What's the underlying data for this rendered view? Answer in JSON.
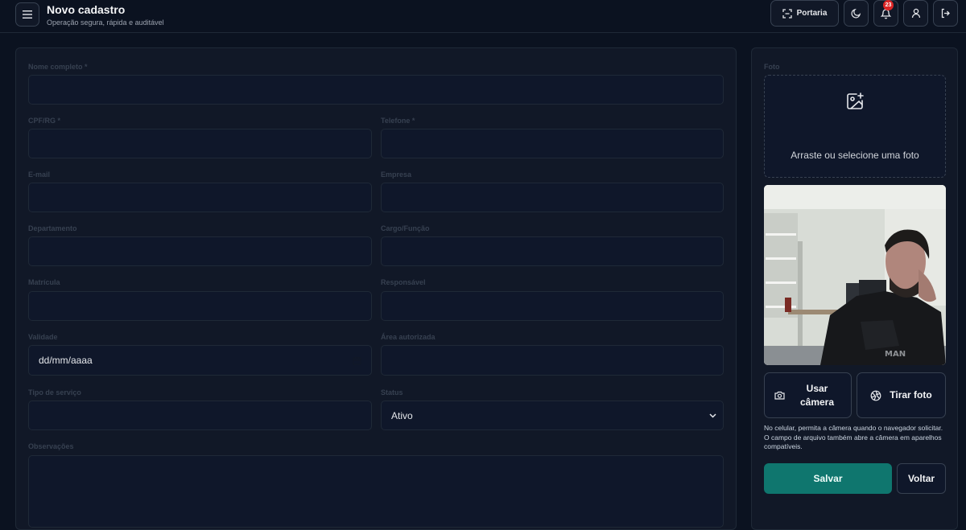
{
  "header": {
    "title": "Novo cadastro",
    "subtitle": "Operação segura, rápida e auditável",
    "portaria_label": "Portaria",
    "notification_count": "23"
  },
  "form": {
    "nome": {
      "label": "Nome completo *",
      "value": ""
    },
    "cpf": {
      "label": "CPF/RG *",
      "value": ""
    },
    "telefone": {
      "label": "Telefone *",
      "value": ""
    },
    "email": {
      "label": "E-mail",
      "value": ""
    },
    "empresa": {
      "label": "Empresa",
      "value": ""
    },
    "departamento": {
      "label": "Departamento",
      "value": ""
    },
    "cargo": {
      "label": "Cargo/Função",
      "value": ""
    },
    "matricula": {
      "label": "Matrícula",
      "value": ""
    },
    "responsavel": {
      "label": "Responsável",
      "value": ""
    },
    "validade": {
      "label": "Validade",
      "placeholder": "dd/mm/aaaa"
    },
    "area": {
      "label": "Área autorizada",
      "value": ""
    },
    "tipo": {
      "label": "Tipo de serviço",
      "value": ""
    },
    "status": {
      "label": "Status",
      "selected": "Ativo"
    },
    "observacoes": {
      "label": "Observações",
      "value": ""
    }
  },
  "photo": {
    "label": "Foto",
    "dropzone_text": "Arraste ou selecione uma foto",
    "use_camera_label": "Usar câmera",
    "take_photo_label": "Tirar foto",
    "note": "No celular, permita a câmera quando o navegador solicitar. O campo de arquivo também abre a câmera em aparelhos compatíveis."
  },
  "actions": {
    "save_label": "Salvar",
    "back_label": "Voltar"
  },
  "colors": {
    "background": "#0b1220",
    "card": "#111827",
    "accent": "#0f766e",
    "badge": "#dc2626"
  }
}
